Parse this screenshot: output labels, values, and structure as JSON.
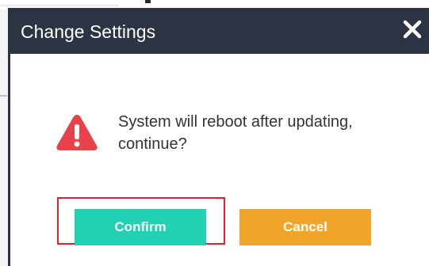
{
  "dialog": {
    "title": "Change Settings",
    "close_icon": "close-icon",
    "message": "System will reboot after updating, continue?",
    "warning_icon": "warning-icon",
    "buttons": {
      "confirm_label": "Confirm",
      "cancel_label": "Cancel"
    },
    "highlighted_button": "Confirm"
  },
  "colors": {
    "titlebar": "#2c3443",
    "confirm": "#22d0b4",
    "cancel": "#f1a52a",
    "warning": "#e8414a",
    "highlight_outline": "#e0202f"
  }
}
